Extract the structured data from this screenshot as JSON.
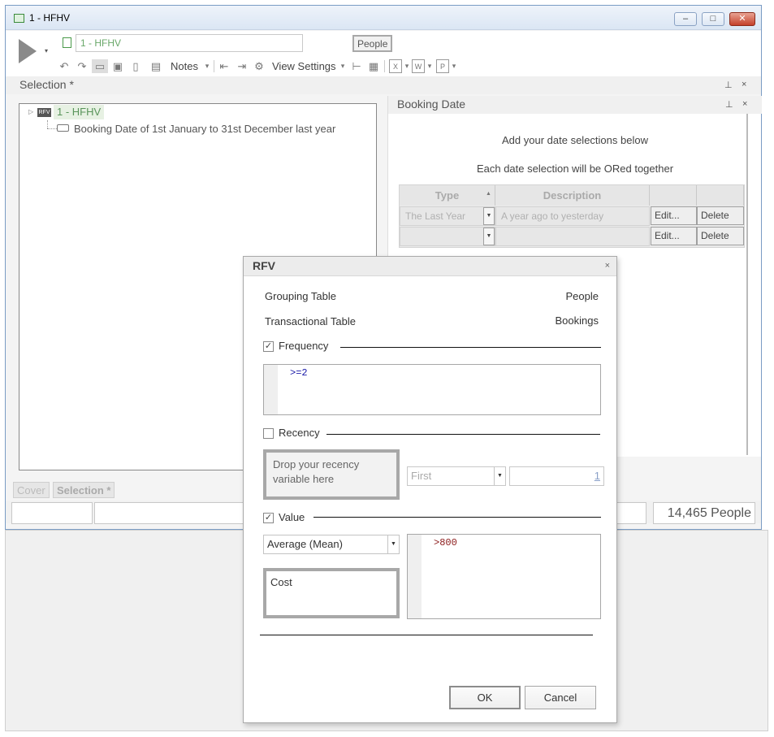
{
  "window": {
    "title": "1 - HFHV",
    "min_glyph": "–",
    "max_glyph": "□",
    "close_glyph": "✕"
  },
  "toolbar": {
    "selection_name": "1 - HFHV",
    "table_badge": "People",
    "notes_label": "Notes",
    "view_settings_label": "View Settings",
    "play_drop_glyph": "▾",
    "undo_glyph": "↶",
    "redo_glyph": "↷",
    "dropdown_glyph": "▾"
  },
  "selection_panel": {
    "title": "Selection *",
    "pin_glyph": "📌",
    "close_glyph": "×"
  },
  "tree": {
    "root_badge": "RFV",
    "root_label": "1 - HFHV",
    "child_label": "Booking Date of 1st January to 31st December last year",
    "expander_glyph": "▷"
  },
  "booking_panel": {
    "title": "Booking Date",
    "line1": "Add your date selections below",
    "line2": "Each date selection will be ORed together",
    "grid": {
      "columns": [
        "Type",
        "Description"
      ],
      "sort_glyph": "▲",
      "rows": [
        {
          "type": "The Last Year",
          "description": "A year ago to yesterday",
          "edit": "Edit...",
          "delete": "Delete"
        },
        {
          "type": "",
          "description": "",
          "edit": "Edit...",
          "delete": "Delete"
        }
      ]
    }
  },
  "tabs": [
    "Cover",
    "Selection *"
  ],
  "status": {
    "count": "14,465 People"
  },
  "rfv": {
    "title": "RFV",
    "close_glyph": "×",
    "grouping_label": "Grouping Table",
    "grouping_value": "People",
    "transactional_label": "Transactional Table",
    "transactional_value": "Bookings",
    "frequency": {
      "label": "Frequency",
      "checked": true,
      "expression": ">=2"
    },
    "recency": {
      "label": "Recency",
      "checked": false,
      "drop_text": "Drop your recency variable here",
      "mode": "First",
      "count": "1"
    },
    "value": {
      "label": "Value",
      "checked": true,
      "aggregate": "Average (Mean)",
      "field": "Cost",
      "expression": ">800"
    },
    "check_glyph": "✓",
    "ok_label": "OK",
    "cancel_label": "Cancel"
  },
  "colors": {
    "accent_green": "#59945a",
    "expression_blue": "#1a1aa8",
    "expression_maroon": "#8b1a1a"
  }
}
